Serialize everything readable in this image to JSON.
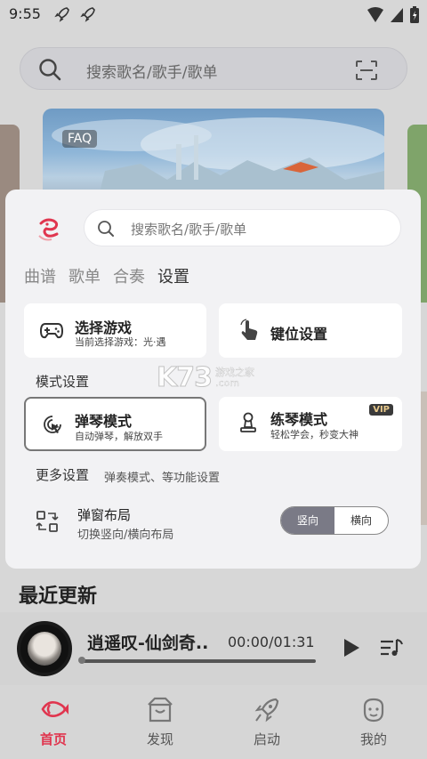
{
  "status": {
    "time": "9:55"
  },
  "top_search": {
    "placeholder": "搜索歌名/歌手/歌单"
  },
  "banner": {
    "badge": "FAQ"
  },
  "panel": {
    "search_placeholder": "搜索歌名/歌手/歌单",
    "tabs": [
      {
        "label": "曲谱",
        "active": false
      },
      {
        "label": "歌单",
        "active": false
      },
      {
        "label": "合奏",
        "active": false
      },
      {
        "label": "设置",
        "active": true
      }
    ],
    "select_game": {
      "title": "选择游戏",
      "subtitle": "当前选择游戏：光·遇"
    },
    "key_settings": {
      "title": "键位设置"
    },
    "mode_section": "模式设置",
    "piano_mode": {
      "title": "弹琴模式",
      "subtitle": "自动弹琴，解放双手"
    },
    "practice_mode": {
      "title": "练琴模式",
      "subtitle": "轻松学会，秒变大神",
      "badge": "VIP"
    },
    "more_settings": {
      "label": "更多设置",
      "hint": "弹奏模式、等功能设置"
    },
    "popup_layout": {
      "title": "弹窗布局",
      "subtitle": "切换竖向/横向布局",
      "options": [
        "竖向",
        "横向"
      ],
      "selected": "竖向"
    }
  },
  "watermark": {
    "big": "K73",
    "line1": "游戏之家",
    "line2": ".com"
  },
  "recent": {
    "title": "最近更新"
  },
  "player": {
    "song": "逍遥叹-仙剑奇..",
    "time": "00:00/01:31",
    "progress": 0.0
  },
  "nav": [
    {
      "label": "首页",
      "icon": "home-fish-icon",
      "active": true
    },
    {
      "label": "发现",
      "icon": "discover-box-icon",
      "active": false
    },
    {
      "label": "启动",
      "icon": "rocket-icon",
      "active": false
    },
    {
      "label": "我的",
      "icon": "profile-face-icon",
      "active": false
    }
  ],
  "colors": {
    "accent": "#e0364f",
    "toggle_selected": "#7a7a86"
  }
}
